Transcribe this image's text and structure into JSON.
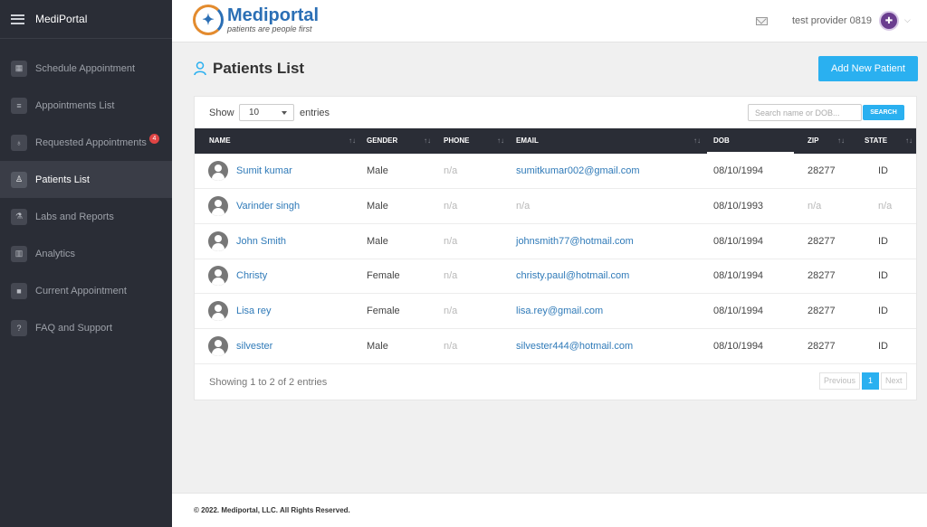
{
  "sidebar": {
    "brand": "MediPortal",
    "items": [
      {
        "label": "Schedule Appointment",
        "icon": "calendar-icon",
        "glyph": "▦"
      },
      {
        "label": "Appointments List",
        "icon": "list-icon",
        "glyph": "≡"
      },
      {
        "label": "Requested Appointments",
        "icon": "stethoscope-icon",
        "glyph": "♁",
        "badge": "4"
      },
      {
        "label": "Patients List",
        "icon": "user-icon",
        "glyph": "♙",
        "active": true
      },
      {
        "label": "Labs and Reports",
        "icon": "flask-icon",
        "glyph": "⚗"
      },
      {
        "label": "Analytics",
        "icon": "chart-icon",
        "glyph": "▥"
      },
      {
        "label": "Current Appointment",
        "icon": "video-icon",
        "glyph": "■"
      },
      {
        "label": "FAQ and Support",
        "icon": "question-icon",
        "glyph": "?"
      }
    ]
  },
  "header": {
    "logo_name": "Mediportal",
    "logo_tagline": "patients are people first",
    "user_name": "test provider 0819"
  },
  "main": {
    "title": "Patients List",
    "add_button": "Add New Patient",
    "show_label": "Show",
    "page_size": "10",
    "entries_label": "entries",
    "search_placeholder": "Search name or DOB...",
    "search_button": "SEARCH",
    "columns": [
      "NAME",
      "GENDER",
      "PHONE",
      "EMAIL",
      "DOB",
      "ZIP",
      "STATE"
    ],
    "rows": [
      {
        "name": "Sumit kumar",
        "gender": "Male",
        "phone": "n/a",
        "email": "sumitkumar002@gmail.com",
        "dob": "08/10/1994",
        "zip": "28277",
        "state": "ID"
      },
      {
        "name": "Varinder singh",
        "gender": "Male",
        "phone": "n/a",
        "email": "n/a",
        "dob": "08/10/1993",
        "zip": "n/a",
        "state": "n/a"
      },
      {
        "name": "John Smith",
        "gender": "Male",
        "phone": "n/a",
        "email": "johnsmith77@hotmail.com",
        "dob": "08/10/1994",
        "zip": "28277",
        "state": "ID"
      },
      {
        "name": "Christy",
        "gender": "Female",
        "phone": "n/a",
        "email": "christy.paul@hotmail.com",
        "dob": "08/10/1994",
        "zip": "28277",
        "state": "ID"
      },
      {
        "name": "Lisa rey",
        "gender": "Female",
        "phone": "n/a",
        "email": "lisa.rey@gmail.com",
        "dob": "08/10/1994",
        "zip": "28277",
        "state": "ID"
      },
      {
        "name": "silvester",
        "gender": "Male",
        "phone": "n/a",
        "email": "silvester444@hotmail.com",
        "dob": "08/10/1994",
        "zip": "28277",
        "state": "ID"
      }
    ],
    "showing_text": "Showing 1 to 2 of 2 entries",
    "pager": {
      "previous": "Previous",
      "current": "1",
      "next": "Next"
    }
  },
  "footer": {
    "copyright": "© 2022. Mediportal, LLC. All Rights Reserved."
  },
  "colors": {
    "sidebar_bg": "#2a2d36",
    "accent": "#2ab0f0",
    "link": "#2f7ab8",
    "badge": "#e04444"
  }
}
